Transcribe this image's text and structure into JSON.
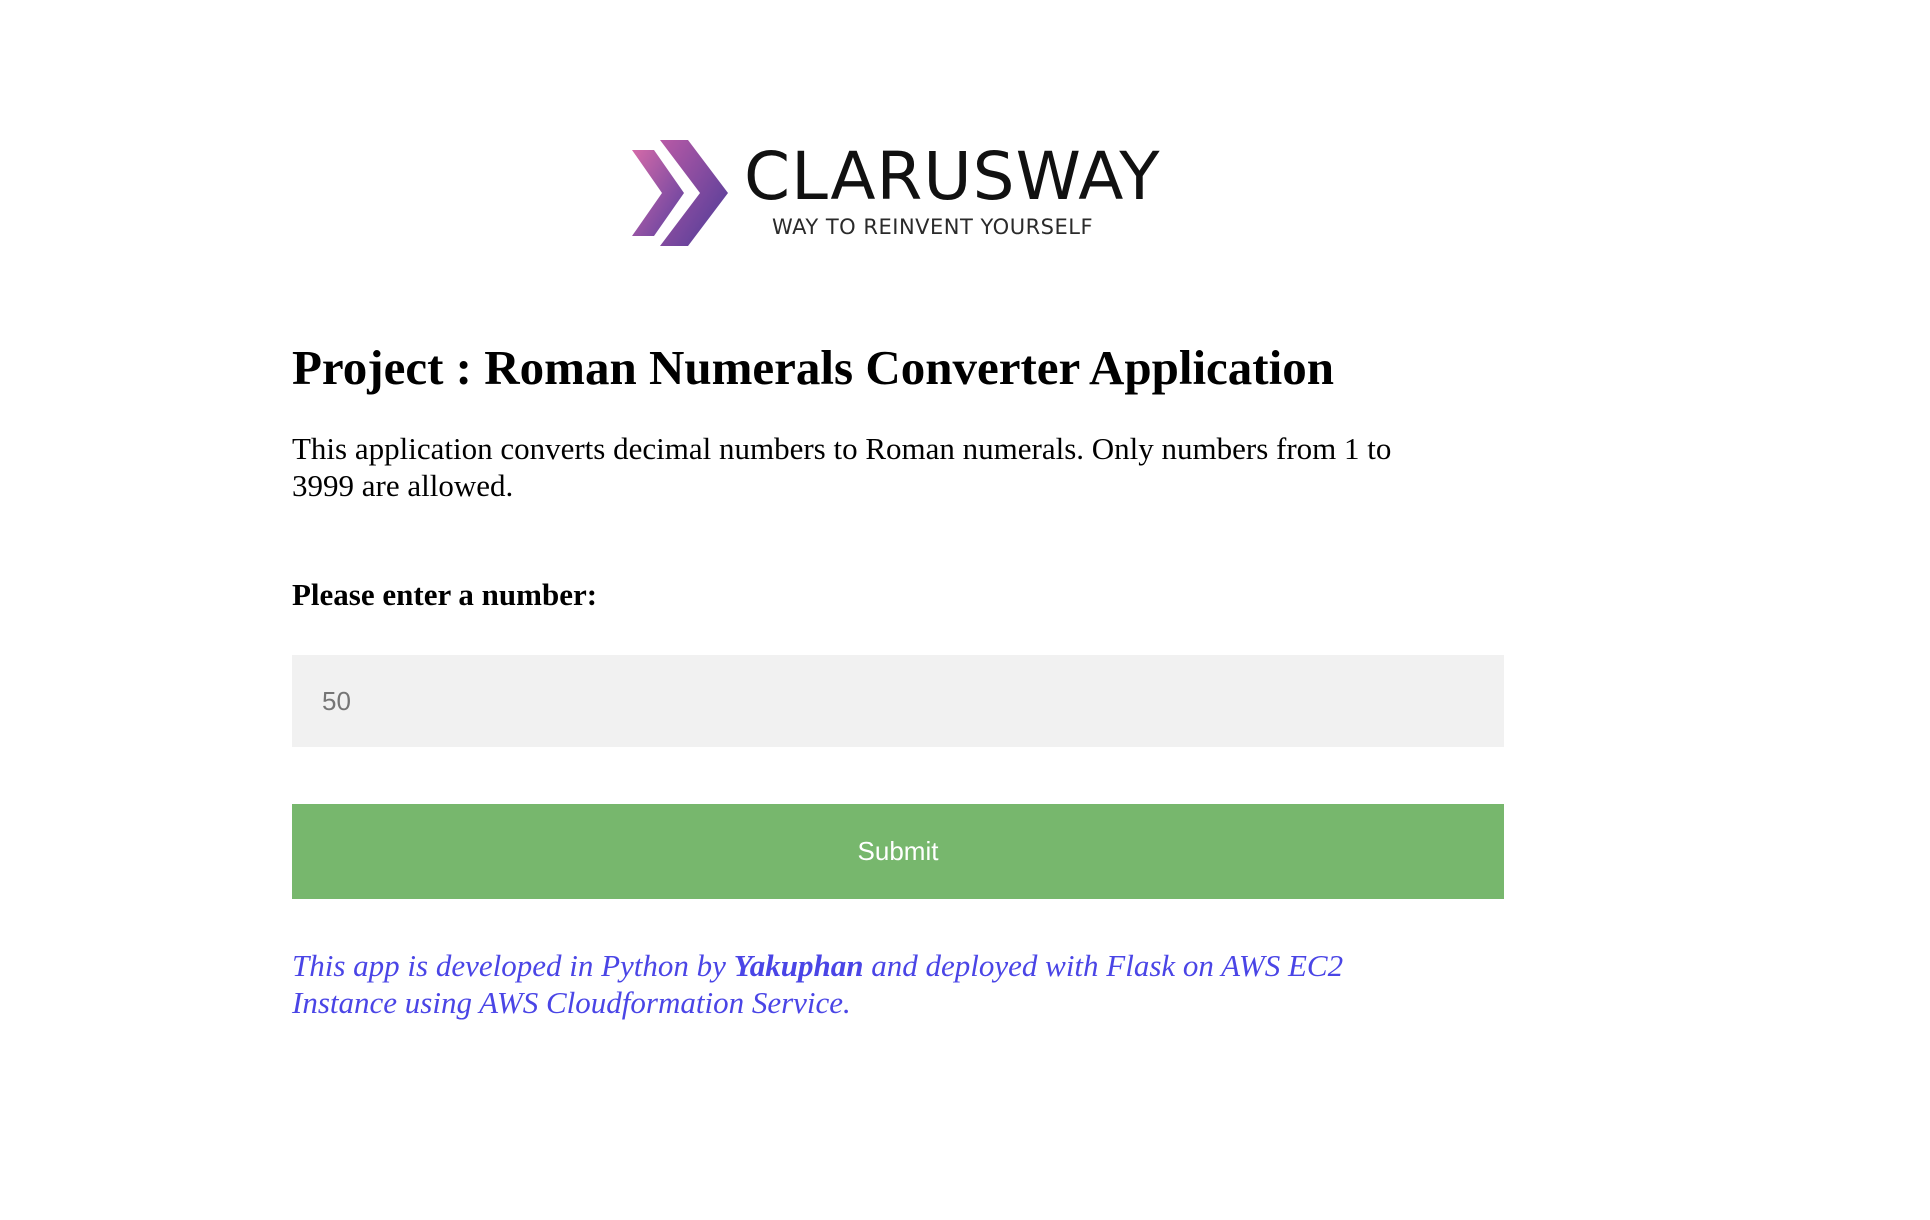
{
  "logo": {
    "wordmark": "CLARUSWAY",
    "tagline": "WAY TO REINVENT YOURSELF",
    "colors": {
      "chevron_light": "#d46aa8",
      "chevron_dark": "#5a3fa0"
    }
  },
  "page": {
    "title": "Project : Roman Numerals Converter Application",
    "description": "This application converts decimal numbers to Roman numerals. Only numbers from 1 to 3999 are allowed."
  },
  "form": {
    "label": "Please enter a number:",
    "input_placeholder": "50",
    "input_value": "",
    "submit_label": "Submit"
  },
  "footer": {
    "prefix": "This app is developed in Python by ",
    "author": "Yakuphan",
    "suffix": " and deployed with Flask on AWS EC2 Instance using AWS Cloudformation Service."
  },
  "colors": {
    "submit_background": "#77b76d",
    "input_background": "#f1f1f1",
    "footer_text": "#4a45e6"
  }
}
